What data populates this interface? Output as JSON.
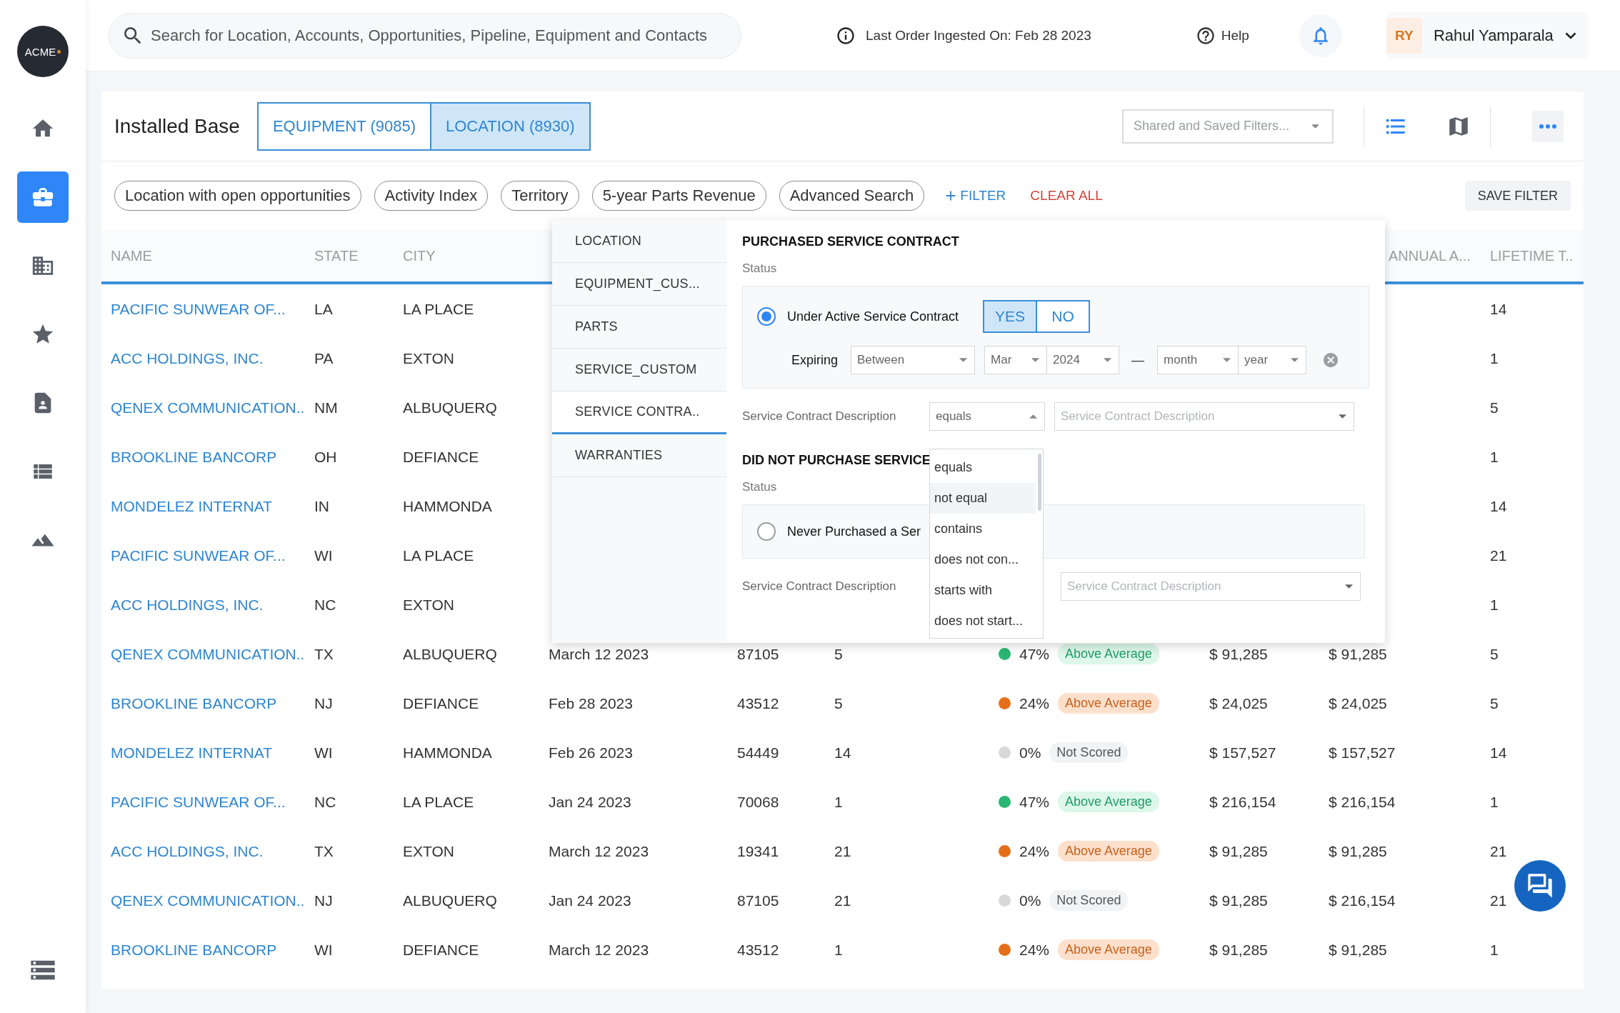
{
  "sidebar": {
    "logo": "ACME",
    "items": [
      {
        "selected": false
      },
      {
        "selected": true
      },
      {
        "selected": false
      },
      {
        "selected": false
      },
      {
        "selected": false
      },
      {
        "selected": false
      },
      {
        "selected": false
      }
    ]
  },
  "topbar": {
    "search": {
      "placeholder": "Search for Location, Accounts, Opportunities, Pipeline, Equipment and Contacts"
    },
    "last_order": "Last Order Ingested On: Feb 28 2023",
    "help": "Help",
    "user": {
      "initials": "RY",
      "name": "Rahul Yamparala"
    }
  },
  "page": {
    "title": "Installed Base",
    "tabs": [
      {
        "label": "EQUIPMENT (9085)",
        "selected": false
      },
      {
        "label": "LOCATION (8930)",
        "selected": true
      }
    ],
    "saved_filters": {
      "placeholder": "Shared and Saved Filters..."
    },
    "views": [
      {
        "selected": true
      },
      {
        "selected": false
      }
    ]
  },
  "filters": {
    "chips": [
      "Location with open opportunities",
      "Activity Index",
      "Territory",
      "5-year Parts Revenue",
      "Advanced Search"
    ],
    "add": "FILTER",
    "clear": "CLEAR ALL",
    "save": "SAVE FILTER"
  },
  "table": {
    "columns": [
      {
        "label": "NAME"
      },
      {
        "label": "STATE"
      },
      {
        "label": "CITY"
      },
      {
        "label": "ANNUAL A..."
      },
      {
        "label": "LIFETIME T.."
      }
    ],
    "rows": [
      {
        "name": "PACIFIC SUNWEAR OF...",
        "state": "LA",
        "city": "LA PLACE",
        "lifetime": "14"
      },
      {
        "name": "ACC HOLDINGS, INC.",
        "state": "PA",
        "city": "EXTON",
        "lifetime": "1"
      },
      {
        "name": "QENEX COMMUNICATION..",
        "state": "NM",
        "city": "ALBUQUERQ",
        "lifetime": "5"
      },
      {
        "name": "BROOKLINE BANCORP",
        "state": "OH",
        "city": "DEFIANCE",
        "lifetime": "1"
      },
      {
        "name": "MONDELEZ INTERNAT",
        "state": "IN",
        "city": "HAMMONDA",
        "lifetime": "14"
      },
      {
        "name": "PACIFIC SUNWEAR OF...",
        "state": "WI",
        "city": "LA PLACE",
        "lifetime": "21"
      },
      {
        "name": "ACC HOLDINGS, INC.",
        "state": "NC",
        "city": "EXTON",
        "lifetime": "1"
      },
      {
        "name": "QENEX COMMUNICATION..",
        "state": "TX",
        "city": "ALBUQUERQ",
        "date": "March 12 2023",
        "zip": "87105",
        "count": "5",
        "score": {
          "percent": "47%",
          "label": "Above Average",
          "color": "#2bb673",
          "kind": "good"
        },
        "revenue": "$ 91,285",
        "total": "$ 91,285",
        "lifetime": "5"
      },
      {
        "name": "BROOKLINE BANCORP",
        "state": "NJ",
        "city": "DEFIANCE",
        "date": "Feb 28 2023",
        "zip": "43512",
        "count": "5",
        "score": {
          "percent": "24%",
          "label": "Above Average",
          "color": "#e46f1b",
          "kind": "warm"
        },
        "revenue": "$ 24,025",
        "total": "$ 24,025",
        "lifetime": "5"
      },
      {
        "name": "MONDELEZ INTERNAT",
        "state": "WI",
        "city": "HAMMONDA",
        "date": "Feb 26 2023",
        "zip": "54449",
        "count": "14",
        "score": {
          "percent": "0%",
          "label": "Not Scored",
          "color": "#d8d8d8",
          "kind": "none"
        },
        "revenue": "$ 157,527",
        "total": "$ 157,527",
        "lifetime": "14"
      },
      {
        "name": "PACIFIC SUNWEAR OF...",
        "state": "NC",
        "city": "LA PLACE",
        "date": "Jan 24 2023",
        "zip": "70068",
        "count": "1",
        "score": {
          "percent": "47%",
          "label": "Above Average",
          "color": "#2bb673",
          "kind": "good"
        },
        "revenue": "$ 216,154",
        "total": "$ 216,154",
        "lifetime": "1"
      },
      {
        "name": "ACC HOLDINGS, INC.",
        "state": "TX",
        "city": "EXTON",
        "date": "March 12 2023",
        "zip": "19341",
        "count": "21",
        "score": {
          "percent": "24%",
          "label": "Above Average",
          "color": "#e46f1b",
          "kind": "warm"
        },
        "revenue": "$ 91,285",
        "total": "$ 91,285",
        "lifetime": "21"
      },
      {
        "name": "QENEX COMMUNICATION..",
        "state": "NJ",
        "city": "ALBUQUERQ",
        "date": "Jan 24 2023",
        "zip": "87105",
        "count": "21",
        "score": {
          "percent": "0%",
          "label": "Not Scored",
          "color": "#d8d8d8",
          "kind": "none"
        },
        "revenue": "$ 91,285",
        "total": "$ 216,154",
        "lifetime": "21"
      },
      {
        "name": "BROOKLINE BANCORP",
        "state": "WI",
        "city": "DEFIANCE",
        "date": "March 12 2023",
        "zip": "43512",
        "count": "1",
        "score": {
          "percent": "24%",
          "label": "Above Average",
          "color": "#e46f1b",
          "kind": "warm"
        },
        "revenue": "$ 91,285",
        "total": "$ 91,285",
        "lifetime": "1"
      }
    ]
  },
  "filter_panel": {
    "categories": [
      {
        "label": "LOCATION",
        "selected": false
      },
      {
        "label": "EQUIPMENT_CUS...",
        "selected": false
      },
      {
        "label": "PARTS",
        "selected": false
      },
      {
        "label": "SERVICE_CUSTOM",
        "selected": false
      },
      {
        "label": "SERVICE CONTRA..",
        "selected": true
      },
      {
        "label": "WARRANTIES",
        "selected": false
      }
    ],
    "purchased": {
      "title": "PURCHASED SERVICE CONTRACT",
      "status_label": "Status",
      "option": {
        "label": "Under Active Service Contract",
        "selected": true
      },
      "toggle": [
        {
          "label": "YES",
          "selected": true
        },
        {
          "label": "NO",
          "selected": false
        }
      ],
      "expiring": {
        "label": "Expiring",
        "range": "Between",
        "from_month": "Mar",
        "from_year": "2024",
        "separator": "—",
        "to_month": "month",
        "to_year": "year"
      },
      "description": {
        "label": "Service Contract Description",
        "operator": "equals",
        "placeholder": "Service Contract Description"
      }
    },
    "operator_menu": [
      {
        "label": "equals",
        "highlighted": false
      },
      {
        "label": "not equal",
        "highlighted": true
      },
      {
        "label": "contains",
        "highlighted": false
      },
      {
        "label": "does not con...",
        "highlighted": false
      },
      {
        "label": "starts with",
        "highlighted": false
      },
      {
        "label": "does not start...",
        "highlighted": false
      }
    ],
    "not_purchased": {
      "title": "DID NOT PURCHASE SERVICE",
      "status_label": "Status",
      "option": {
        "label": "Never Purchased a Ser",
        "selected": false
      },
      "description": {
        "label": "Service Contract Description",
        "placeholder": "Service Contract Description"
      }
    }
  }
}
